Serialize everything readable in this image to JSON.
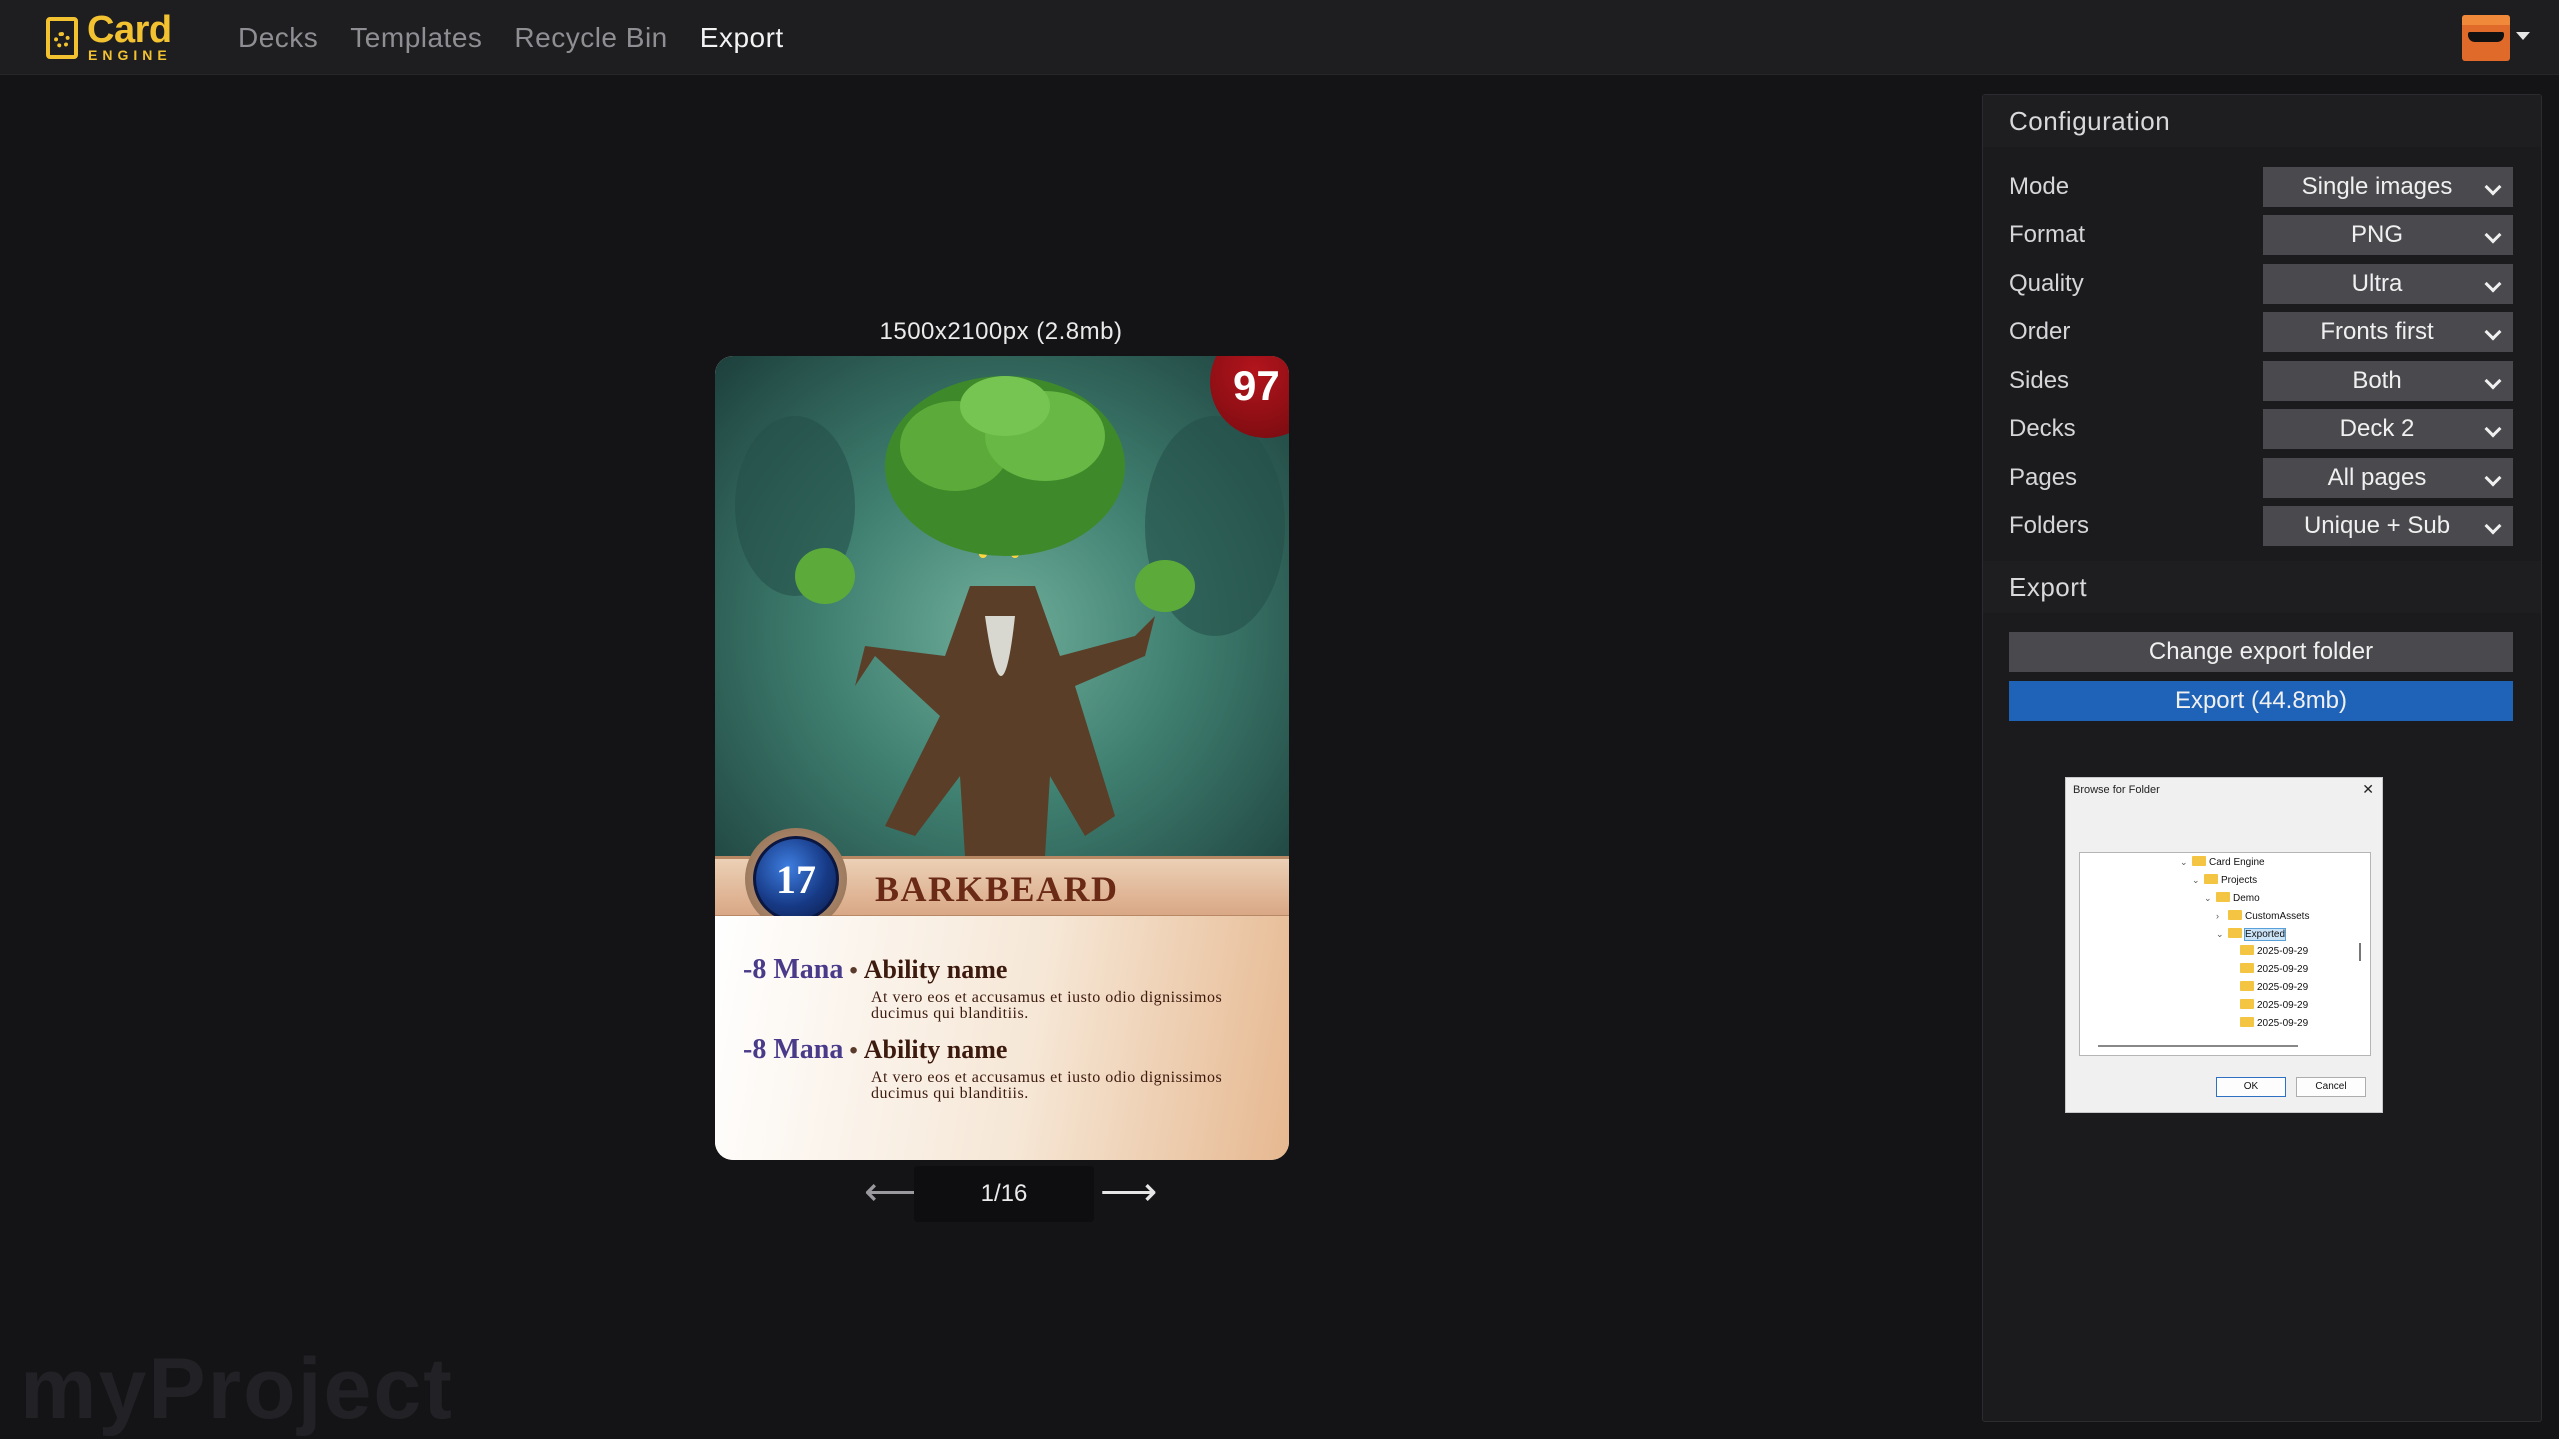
{
  "app": {
    "logo_word": "Card",
    "logo_sub": "ENGINE",
    "nav": [
      {
        "label": "Decks",
        "active": false
      },
      {
        "label": "Templates",
        "active": false
      },
      {
        "label": "Recycle Bin",
        "active": false
      },
      {
        "label": "Export",
        "active": true
      }
    ],
    "user_icon": "sunglasses-avatar-icon"
  },
  "preview": {
    "size_label": "1500x2100px (2.8mb)",
    "card": {
      "hp": "97",
      "mana": "17",
      "name": "BARKBEARD",
      "abilities": [
        {
          "cost": "-8 Mana",
          "name": "Ability name",
          "desc": "At vero eos et accusamus et iusto odio dignissimos ducimus qui blanditiis."
        },
        {
          "cost": "-8 Mana",
          "name": "Ability name",
          "desc": "At vero eos et accusamus et iusto odio dignissimos ducimus qui blanditiis."
        }
      ]
    },
    "pager": {
      "counter": "1/16",
      "prev_icon": "arrow-left-icon",
      "next_icon": "arrow-right-icon"
    }
  },
  "watermark": "myProject",
  "configuration": {
    "title": "Configuration",
    "rows": [
      {
        "label": "Mode",
        "value": "Single images"
      },
      {
        "label": "Format",
        "value": "PNG"
      },
      {
        "label": "Quality",
        "value": "Ultra"
      },
      {
        "label": "Order",
        "value": "Fronts first"
      },
      {
        "label": "Sides",
        "value": "Both"
      },
      {
        "label": "Decks",
        "value": "Deck 2"
      },
      {
        "label": "Pages",
        "value": "All pages"
      },
      {
        "label": "Folders",
        "value": "Unique + Sub"
      }
    ]
  },
  "export": {
    "title": "Export",
    "change_folder_label": "Change export folder",
    "export_label": "Export (44.8mb)"
  },
  "dialog": {
    "title": "Browse for Folder",
    "tree": [
      "Card Engine",
      "Projects",
      "Demo",
      "CustomAssets",
      "Exported",
      "2025-09-29",
      "2025-09-29",
      "2025-09-29",
      "2025-09-29",
      "2025-09-29"
    ],
    "ok_label": "OK",
    "cancel_label": "Cancel"
  },
  "colors": {
    "accent_yellow": "#f2c230",
    "export_blue": "#1f63b8",
    "hp_red": "#9b1016",
    "mana_blue": "#173a86"
  }
}
